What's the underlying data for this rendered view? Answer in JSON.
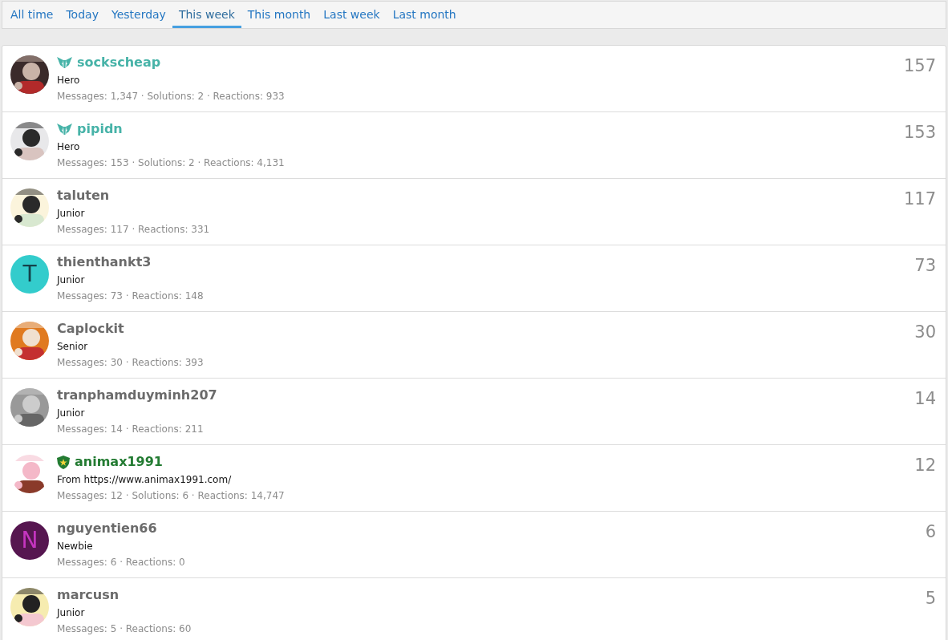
{
  "tabs": [
    {
      "label": "All time",
      "selected": false
    },
    {
      "label": "Today",
      "selected": false
    },
    {
      "label": "Yesterday",
      "selected": false
    },
    {
      "label": "This week",
      "selected": true
    },
    {
      "label": "This month",
      "selected": false
    },
    {
      "label": "Last week",
      "selected": false
    },
    {
      "label": "Last month",
      "selected": false
    }
  ],
  "members": [
    {
      "name": "sockscheap",
      "color": "#47b3a8",
      "badge": {
        "kind": "wings"
      },
      "title": "Hero",
      "stats": "Messages: 1,347 · Solutions: 2 · Reactions: 933",
      "count": "157"
    },
    {
      "name": "pipidn",
      "color": "#47b3a8",
      "badge": {
        "kind": "wings"
      },
      "title": "Hero",
      "stats": "Messages: 153 · Solutions: 2 · Reactions: 4,131",
      "count": "153"
    },
    {
      "name": "taluten",
      "color": "#6b6b6b",
      "title": "Junior",
      "stats": "Messages: 117 · Reactions: 331",
      "count": "117"
    },
    {
      "name": "thienthankt3",
      "color": "#6b6b6b",
      "title": "Junior",
      "stats": "Messages: 73 · Reactions: 148",
      "count": "73",
      "avatar": {
        "kind": "letter",
        "letter": "T",
        "color": "#33cccc"
      }
    },
    {
      "name": "Caplockit",
      "color": "#6b6b6b",
      "title": "Senior",
      "stats": "Messages: 30 · Reactions: 393",
      "count": "30"
    },
    {
      "name": "tranphamduyminh207",
      "color": "#6b6b6b",
      "title": "Junior",
      "stats": "Messages: 14 · Reactions: 211",
      "count": "14"
    },
    {
      "name": "animax1991",
      "color": "#237b32",
      "badge": {
        "kind": "shield"
      },
      "title": "From https://www.animax1991.com/",
      "stats": "Messages: 12 · Solutions: 6 · Reactions: 14,747",
      "count": "12"
    },
    {
      "name": "nguyentien66",
      "color": "#6b6b6b",
      "title": "Newbie",
      "stats": "Messages: 6 · Reactions: 0",
      "count": "6",
      "avatar": {
        "kind": "letter",
        "letter": "N",
        "color": "#561650"
      }
    },
    {
      "name": "marcusn",
      "color": "#6b6b6b",
      "title": "Junior",
      "stats": "Messages: 5 · Reactions: 60",
      "count": "5"
    }
  ]
}
